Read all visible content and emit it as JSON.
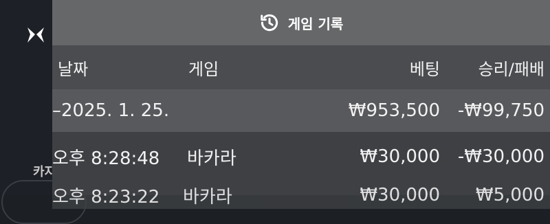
{
  "background": {
    "sidebar_text": "카지"
  },
  "panel": {
    "title": "게임 기록",
    "columns": [
      "날짜",
      "게임",
      "베팅",
      "승리/패배"
    ],
    "date_row": {
      "date": "–2025. 1. 25.",
      "bet": "₩953,500",
      "result": "-₩99,750"
    },
    "rows": [
      {
        "time": "오후 8:28:48",
        "game": "바카라",
        "bet": "₩30,000",
        "result": "-₩30,000"
      },
      {
        "time": "오후 8:23:22",
        "game": "바카라",
        "bet": "₩30,000",
        "result": "₩5,000"
      }
    ]
  },
  "colors": {
    "header_bg": "#666769",
    "panel_bg": "#46484c",
    "text": "#f2f2f2"
  }
}
